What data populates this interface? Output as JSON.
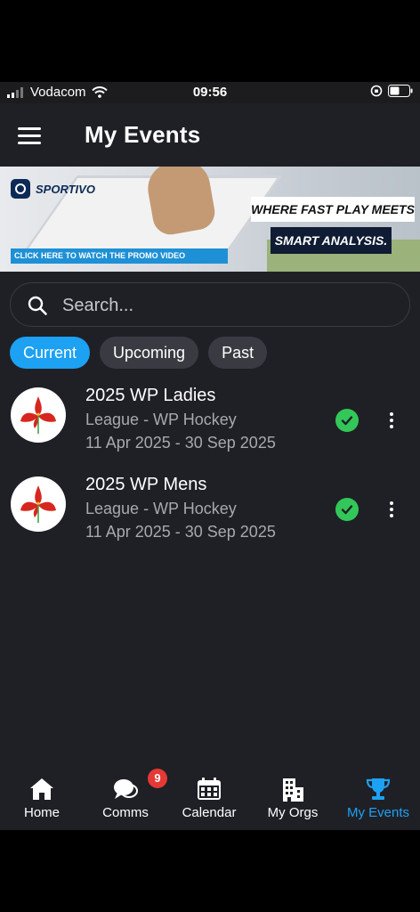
{
  "status_bar": {
    "carrier": "Vodacom",
    "time": "09:56"
  },
  "header": {
    "title": "My Events"
  },
  "banner": {
    "brand": "SPORTIVO",
    "promo_text": "CLICK HERE TO WATCH THE PROMO VIDEO",
    "tagline_1": "WHERE FAST PLAY MEETS",
    "tagline_2": "SMART ANALYSIS."
  },
  "search": {
    "placeholder": "Search..."
  },
  "filters": [
    {
      "label": "Current",
      "active": true
    },
    {
      "label": "Upcoming",
      "active": false
    },
    {
      "label": "Past",
      "active": false
    }
  ],
  "events": [
    {
      "name": "2025 WP Ladies",
      "type": "League - WP Hockey",
      "dates": "11 Apr 2025 - 30 Sep 2025"
    },
    {
      "name": "2025 WP Mens",
      "type": "League - WP Hockey",
      "dates": "11 Apr 2025 - 30 Sep 2025"
    }
  ],
  "tabs": [
    {
      "label": "Home",
      "icon": "home-icon"
    },
    {
      "label": "Comms",
      "icon": "chat-icon",
      "badge": "9"
    },
    {
      "label": "Calendar",
      "icon": "calendar-icon"
    },
    {
      "label": "My Orgs",
      "icon": "building-icon"
    },
    {
      "label": "My Events",
      "icon": "trophy-icon",
      "active": true
    }
  ],
  "colors": {
    "accent": "#1da1f2",
    "background": "#1f2026",
    "success": "#33c759",
    "badge": "#e53935",
    "logo_red": "#d7261f"
  }
}
